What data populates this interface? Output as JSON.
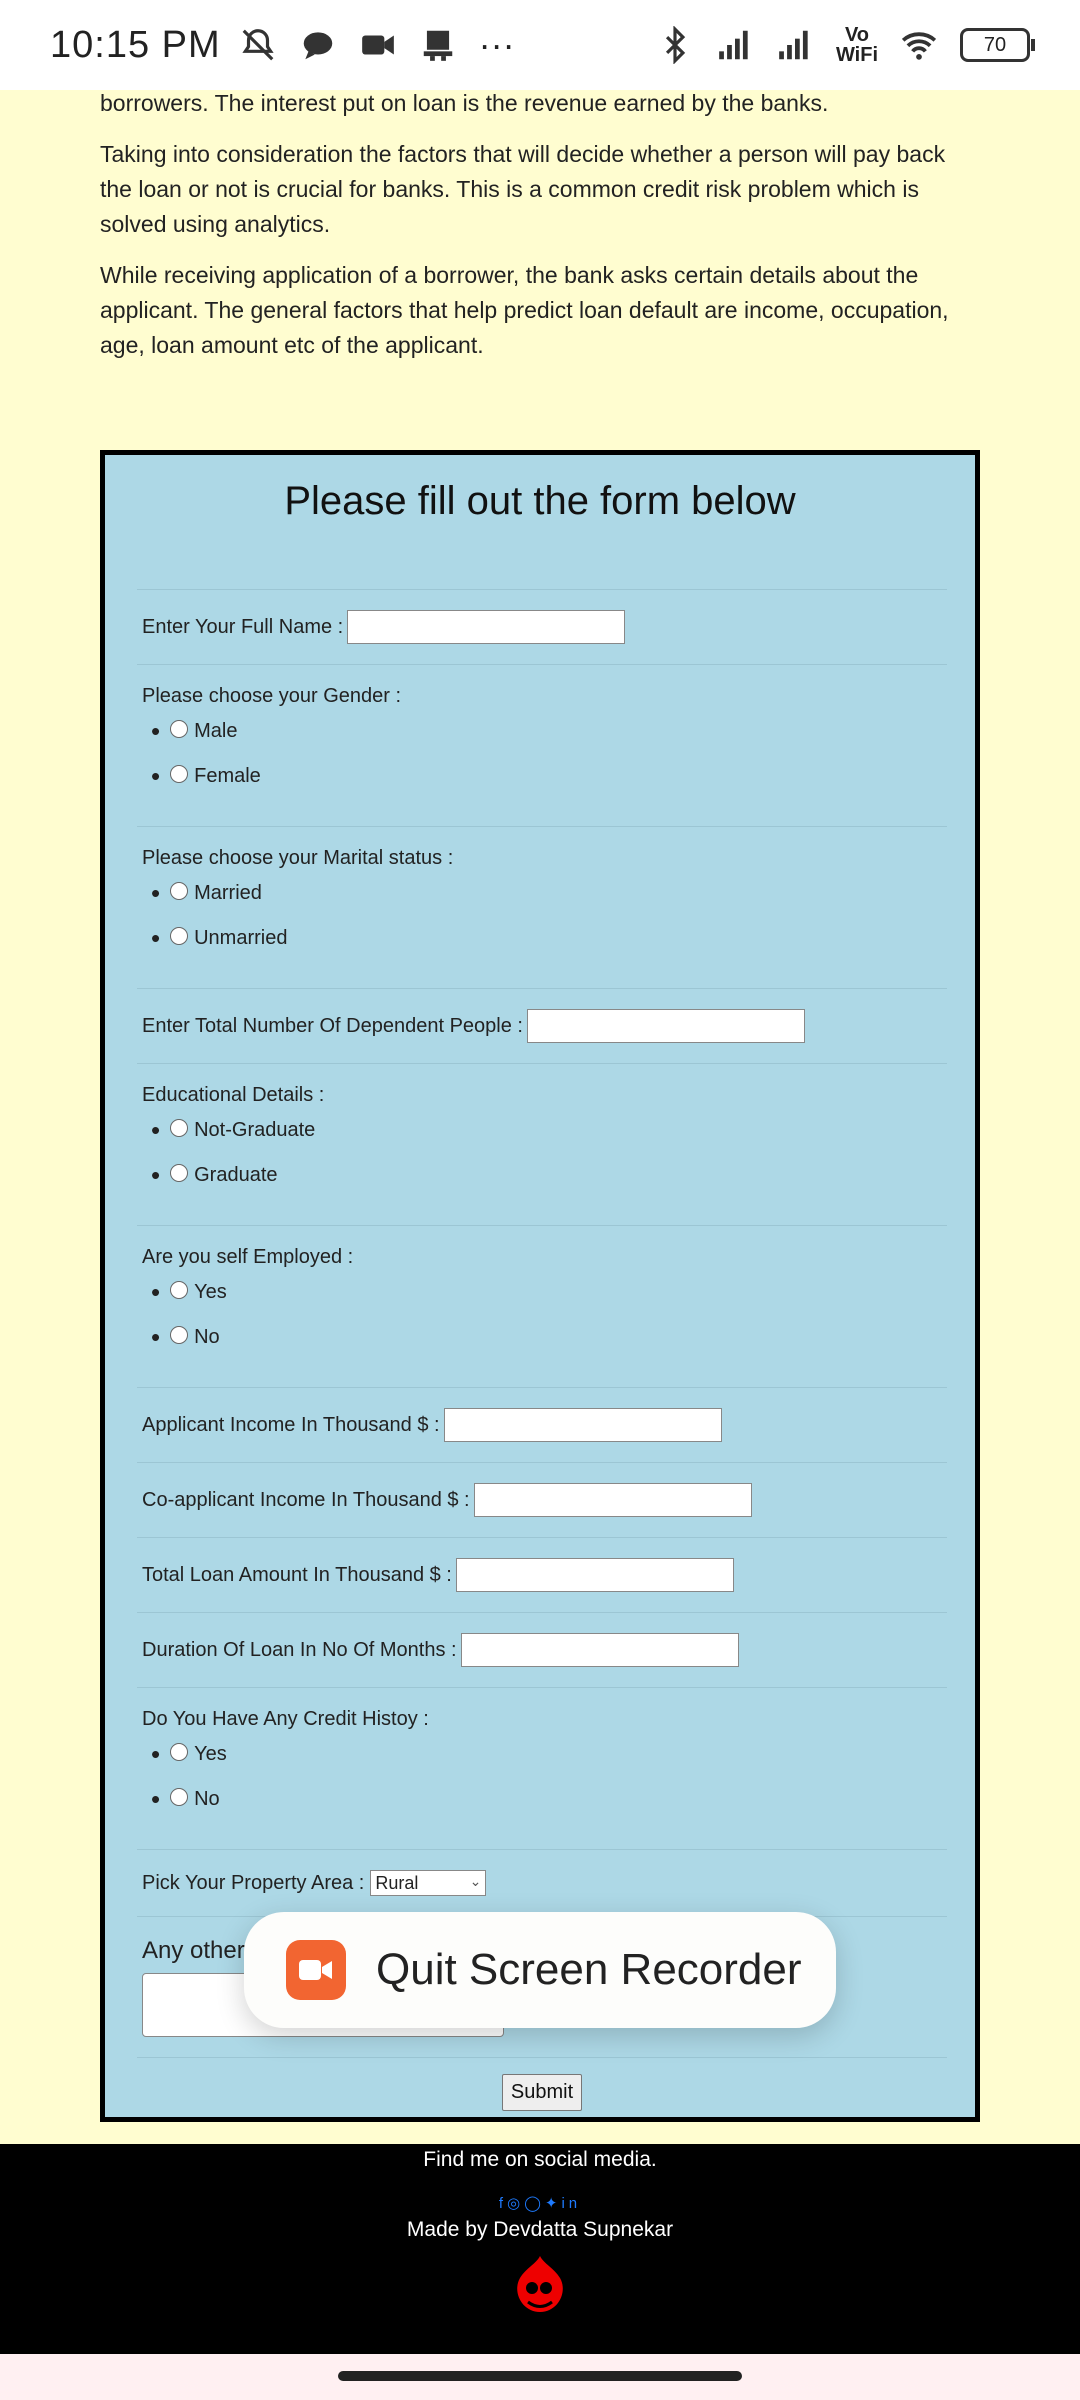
{
  "status_bar": {
    "time": "10:15 PM",
    "more": "···",
    "volte_top": "Vo",
    "volte_bottom": "WiFi",
    "battery": "70"
  },
  "intro": {
    "p1": "borrowers. The interest put on loan is the revenue earned by the banks.",
    "p2": "Taking into consideration the factors that will decide whether a person will pay back the loan or not is crucial for banks. This is a common credit risk problem which is solved using analytics.",
    "p3": "While receiving application of a borrower, the bank asks certain details about the applicant. The general factors that help predict loan default are income, occupation, age, loan amount etc of the applicant."
  },
  "form": {
    "title": "Please fill out the form below",
    "full_name_label": "Enter Your Full Name :",
    "gender_label": "Please choose your Gender :",
    "gender_options": [
      "Male",
      "Female"
    ],
    "marital_label": "Please choose your Marital status :",
    "marital_options": [
      "Married",
      "Unmarried"
    ],
    "dependents_label": "Enter Total Number Of Dependent People :",
    "education_label": "Educational Details :",
    "education_options": [
      "Not-Graduate",
      "Graduate"
    ],
    "self_employed_label": "Are you self Employed :",
    "self_employed_options": [
      "Yes",
      "No"
    ],
    "applicant_income_label": "Applicant Income In Thousand $ :",
    "coapplicant_income_label": "Co-applicant Income In Thousand $ :",
    "loan_amount_label": "Total Loan Amount In Thousand $ :",
    "loan_duration_label": "Duration Of Loan In No Of Months :",
    "credit_history_label": "Do You Have Any Credit Histoy :",
    "credit_history_options": [
      "Yes",
      "No"
    ],
    "property_area_label": "Pick Your Property Area :",
    "property_area_value": "Rural",
    "other_label": "Any other f",
    "submit_label": "Submit"
  },
  "recorder": {
    "label": "Quit Screen Recorder",
    "accent": "#f26531"
  },
  "footer": {
    "find_text": "Find me on social media.",
    "social_icons": [
      "facebook-icon",
      "instagram-icon",
      "github-icon",
      "twitter-icon",
      "linkedin-icon"
    ],
    "social_glyphs": "f◎◯🐦in",
    "made_by": "Made by Devdatta Supnekar"
  },
  "colors": {
    "page_bg": "#fffdd0",
    "card_bg": "#add8e6",
    "footer_bg": "#000000",
    "social": "#1e7bff"
  }
}
